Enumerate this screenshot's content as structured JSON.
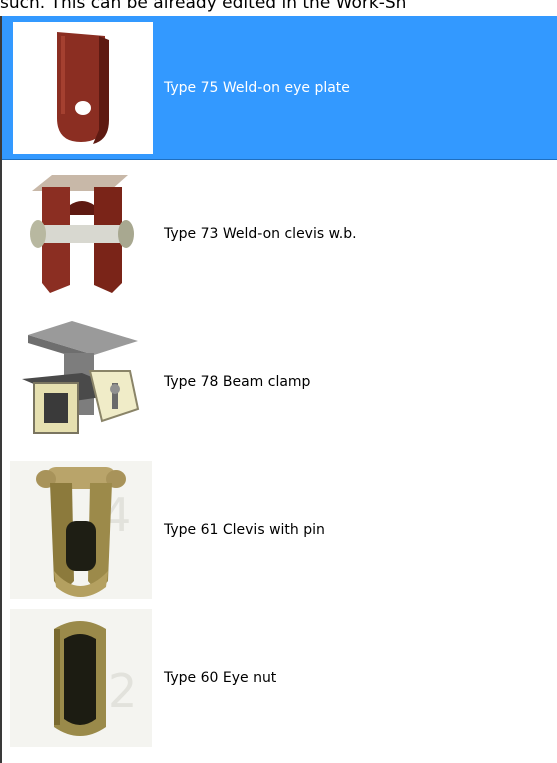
{
  "caption": "such. This can be already edited in the Work-Sh",
  "items": [
    {
      "label": "Type 75 Weld-on eye plate",
      "icon": "eye-plate-icon",
      "selected": true
    },
    {
      "label": "Type 73 Weld-on clevis w.b.",
      "icon": "clevis-icon",
      "selected": false
    },
    {
      "label": "Type 78 Beam clamp",
      "icon": "beam-clamp-icon",
      "selected": false
    },
    {
      "label": "Type 61 Clevis with pin",
      "icon": "clevis-pin-icon",
      "selected": false
    },
    {
      "label": "Type 60 Eye nut",
      "icon": "eye-nut-icon",
      "selected": false
    }
  ],
  "colors": {
    "selection": "#3399ff",
    "part_red": "#8b2e22",
    "metal": "#c8c8b8"
  }
}
